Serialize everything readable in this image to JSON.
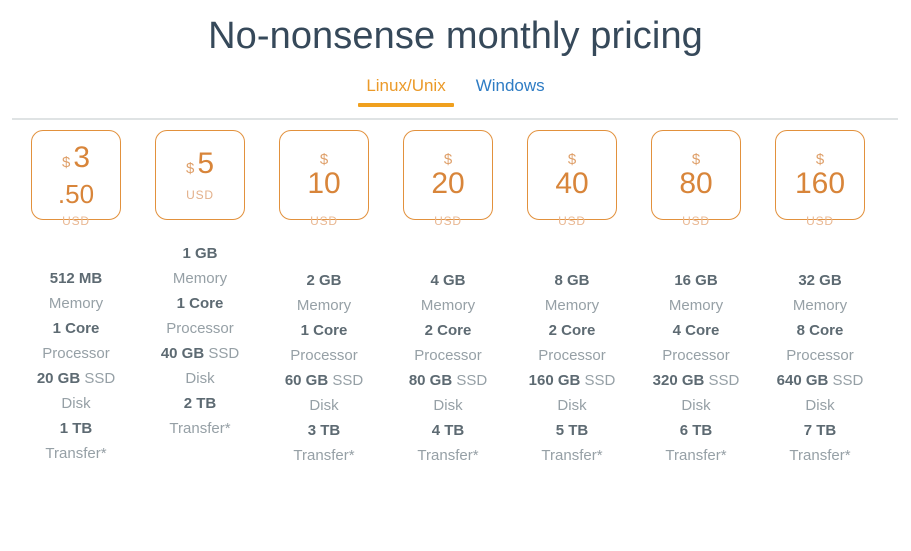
{
  "header": {
    "title": "No-nonsense monthly pricing"
  },
  "tabs": [
    {
      "label": "Linux/Unix",
      "active": true
    },
    {
      "label": "Windows",
      "active": false
    }
  ],
  "colors": {
    "title": "#36495a",
    "tab_active": "#eb9a29",
    "tab_underline": "#f0a01e",
    "tab_inactive": "#2e7cc4",
    "card_border": "#e2913d",
    "price": "#d8853a",
    "usd": "#e9b893",
    "spec_value": "#5d6a72",
    "spec_label": "#96a0a6",
    "rule": "#dfe3e4"
  },
  "currency_symbol": "$",
  "currency_code": "USD",
  "plans": [
    {
      "price_dollars": "3",
      "price_cents": ".50",
      "price_layout": "inline-with-cents",
      "usd_position": "edge",
      "specs_offset": "default",
      "memory_value": "512 MB",
      "memory_label": "Memory",
      "processor_value": "1 Core",
      "processor_label": "Processor",
      "disk_value": "20 GB",
      "disk_value_suffix": "SSD",
      "disk_label": "Disk",
      "transfer_value": "1 TB",
      "transfer_label": "Transfer*"
    },
    {
      "price_dollars": "5",
      "price_cents": "",
      "price_layout": "inline",
      "usd_position": "inside",
      "specs_offset": "raise",
      "memory_value": "1 GB",
      "memory_label": "Memory",
      "processor_value": "1 Core",
      "processor_label": "Processor",
      "disk_value": "40 GB",
      "disk_value_suffix": "SSD",
      "disk_label": "Disk",
      "transfer_value": "2 TB",
      "transfer_label": "Transfer*"
    },
    {
      "price_dollars": "10",
      "price_cents": "",
      "price_layout": "stacked",
      "usd_position": "edge",
      "specs_offset": "raise-mid",
      "memory_value": "2 GB",
      "memory_label": "Memory",
      "processor_value": "1 Core",
      "processor_label": "Processor",
      "disk_value": "60 GB",
      "disk_value_suffix": "SSD",
      "disk_label": "Disk",
      "transfer_value": "3 TB",
      "transfer_label": "Transfer*"
    },
    {
      "price_dollars": "20",
      "price_cents": "",
      "price_layout": "stacked",
      "usd_position": "edge",
      "specs_offset": "raise-mid",
      "memory_value": "4 GB",
      "memory_label": "Memory",
      "processor_value": "2 Core",
      "processor_label": "Processor",
      "disk_value": "80 GB",
      "disk_value_suffix": "SSD",
      "disk_label": "Disk",
      "transfer_value": "4 TB",
      "transfer_label": "Transfer*"
    },
    {
      "price_dollars": "40",
      "price_cents": "",
      "price_layout": "stacked",
      "usd_position": "edge",
      "specs_offset": "raise-mid",
      "memory_value": "8 GB",
      "memory_label": "Memory",
      "processor_value": "2 Core",
      "processor_label": "Processor",
      "disk_value": "160 GB",
      "disk_value_suffix": "SSD",
      "disk_label": "Disk",
      "transfer_value": "5 TB",
      "transfer_label": "Transfer*"
    },
    {
      "price_dollars": "80",
      "price_cents": "",
      "price_layout": "stacked",
      "usd_position": "edge",
      "specs_offset": "raise-mid",
      "memory_value": "16 GB",
      "memory_label": "Memory",
      "processor_value": "4 Core",
      "processor_label": "Processor",
      "disk_value": "320 GB",
      "disk_value_suffix": "SSD",
      "disk_label": "Disk",
      "transfer_value": "6 TB",
      "transfer_label": "Transfer*"
    },
    {
      "price_dollars": "160",
      "price_cents": "",
      "price_layout": "stacked",
      "usd_position": "edge",
      "specs_offset": "raise-mid",
      "memory_value": "32 GB",
      "memory_label": "Memory",
      "processor_value": "8 Core",
      "processor_label": "Processor",
      "disk_value": "640 GB",
      "disk_value_suffix": "SSD",
      "disk_label": "Disk",
      "transfer_value": "7 TB",
      "transfer_label": "Transfer*"
    }
  ]
}
